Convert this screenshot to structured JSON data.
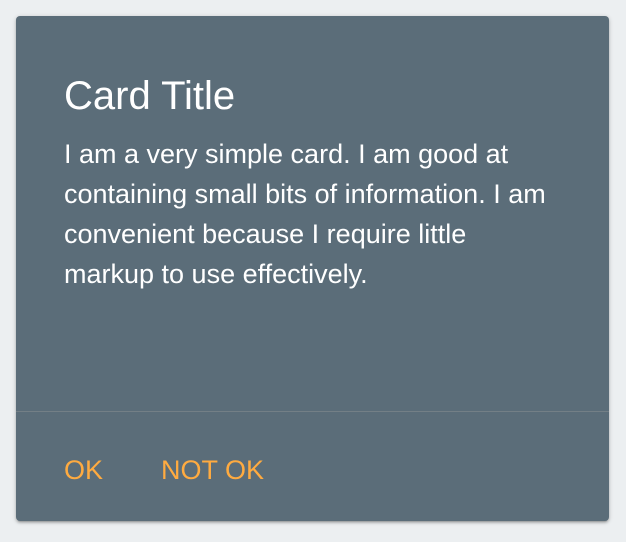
{
  "card": {
    "title": "Card Title",
    "text": "I am a very simple card. I am good at containing small bits of information. I am convenient because I require little markup to use effectively.",
    "actions": [
      {
        "label": "OK"
      },
      {
        "label": "NOT OK"
      }
    ]
  },
  "colors": {
    "page_background": "#eceff1",
    "card_background": "#5b6d79",
    "text": "#ffffff",
    "action_link": "#ffab40"
  }
}
